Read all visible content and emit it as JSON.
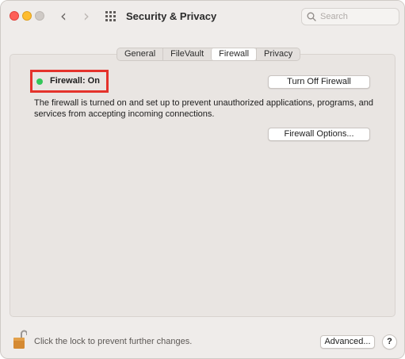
{
  "window": {
    "title": "Security & Privacy"
  },
  "search": {
    "placeholder": "Search"
  },
  "tabs": [
    {
      "label": "General",
      "active": false
    },
    {
      "label": "FileVault",
      "active": false
    },
    {
      "label": "Firewall",
      "active": true
    },
    {
      "label": "Privacy",
      "active": false
    }
  ],
  "firewall": {
    "status_label": "Firewall: On",
    "status_color": "#34c759",
    "toggle_button_label": "Turn Off Firewall",
    "description": "The firewall is turned on and set up to prevent unauthorized applications, programs, and services from accepting incoming connections.",
    "options_button_label": "Firewall Options..."
  },
  "footer": {
    "lock_text": "Click the lock to prevent further changes.",
    "advanced_label": "Advanced...",
    "help_label": "?"
  },
  "colors": {
    "highlight_box": "#e4322b",
    "window_bg": "#efecea"
  }
}
